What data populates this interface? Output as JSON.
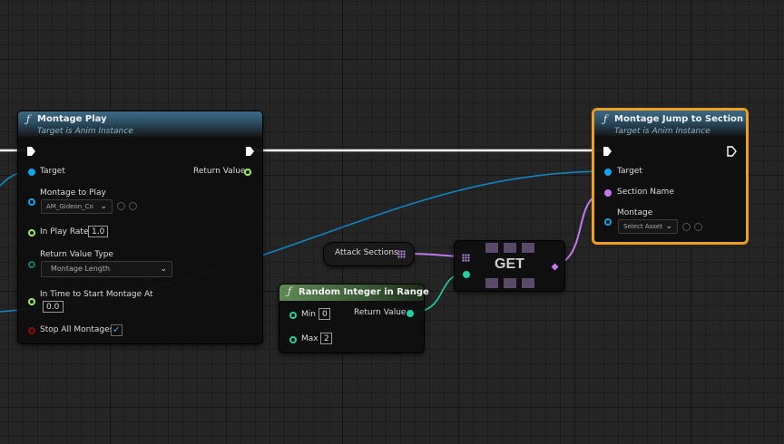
{
  "colors": {
    "exec_wire": "#ffffff",
    "object_pin": "#0ea5ef",
    "float_pin": "#9ef05a",
    "integer_pin": "#1fd1a5",
    "name_pin": "#c07aee",
    "enum_pin": "#0f7b6e",
    "bool_pin": "#8b0a0a",
    "selected_outline": "#f0a020"
  },
  "montage_play": {
    "icon": "function-icon",
    "title": "Montage Play",
    "subtitle": "Target is Anim Instance",
    "pins": {
      "target": "Target",
      "montage_to_play": "Montage to Play",
      "montage_asset_value": "AM_Gideon_Co",
      "in_play_rate": "In Play Rate",
      "in_play_rate_value": "1.0",
      "return_value_type": "Return Value Type",
      "return_value_type_value": "Montage Length",
      "in_time_to_start": "In Time to Start Montage At",
      "in_time_to_start_value": "0.0",
      "stop_all_montages": "Stop All Montages",
      "stop_all_montages_checked": true,
      "return_value": "Return Value"
    }
  },
  "attack_sections": {
    "label": "Attack Sections"
  },
  "get_node": {
    "label": "GET"
  },
  "random_integer": {
    "icon": "function-icon",
    "title": "Random Integer in Range",
    "pins": {
      "min": "Min",
      "min_value": "0",
      "max": "Max",
      "max_value": "2",
      "return_value": "Return Value"
    }
  },
  "montage_jump": {
    "icon": "function-icon",
    "title": "Montage Jump to Section",
    "subtitle": "Target is Anim Instance",
    "pins": {
      "target": "Target",
      "section_name": "Section Name",
      "montage": "Montage",
      "montage_asset_value": "Select Asset"
    }
  }
}
